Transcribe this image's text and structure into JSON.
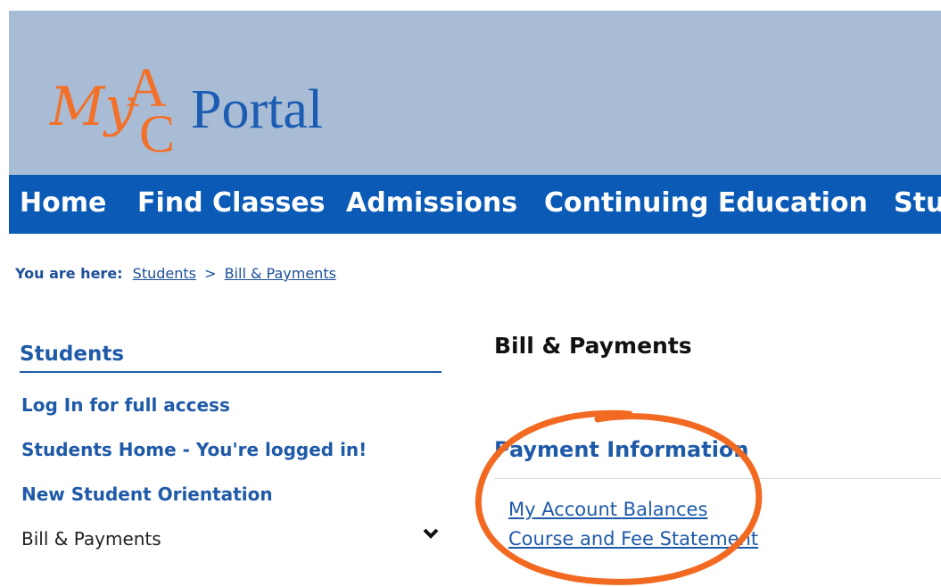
{
  "header": {
    "logo": {
      "my": "My",
      "a": "A",
      "c": "C",
      "portal": "Portal"
    }
  },
  "nav": {
    "items": [
      "Home",
      "Find Classes",
      "Admissions",
      "Continuing Education",
      "Stu"
    ]
  },
  "breadcrumb": {
    "label": "You are here:",
    "items": [
      "Students",
      "Bill & Payments"
    ],
    "separator": ">"
  },
  "sidebar": {
    "title": "Students",
    "links": [
      "Log In for full access",
      "Students Home - You're logged in!",
      "New Student Orientation"
    ],
    "current": "Bill & Payments",
    "chevron_icon": "chevron-down-icon"
  },
  "main": {
    "title": "Bill & Payments",
    "section_title": "Payment Information",
    "links": [
      "My Account Balances",
      "Course and Fee Statement"
    ]
  },
  "colors": {
    "header_band": "#a8bcd6",
    "nav_bar": "#0a5ab6",
    "brand_orange": "#f37028",
    "brand_blue": "#1c5cb2",
    "link_blue": "#1f5aa8",
    "annotation": "#f26a21"
  }
}
